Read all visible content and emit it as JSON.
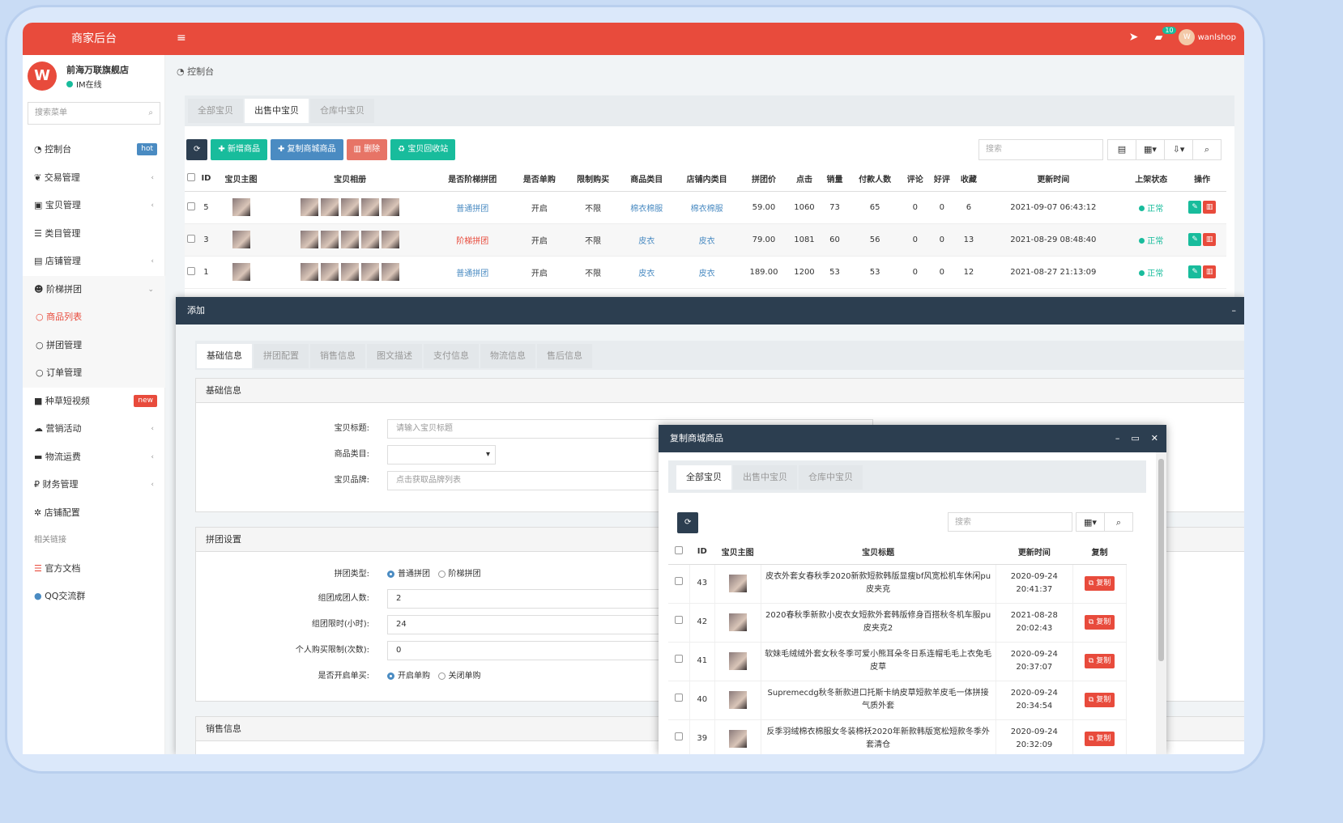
{
  "app": {
    "title": "商家后台",
    "menu_icon": "hamburger-icon",
    "notify_count": "10",
    "user": "wanlshop",
    "avatar_letter": "W"
  },
  "shop": {
    "name": "前海万联旗舰店",
    "status": "IM在线"
  },
  "sidebar": {
    "search_placeholder": "搜索菜单",
    "items": [
      {
        "label": "控制台",
        "tag": "hot",
        "icon": "dashboard-icon"
      },
      {
        "label": "交易管理",
        "icon": "leaf-icon"
      },
      {
        "label": "宝贝管理",
        "icon": "shop-icon"
      },
      {
        "label": "类目管理",
        "icon": "list-icon"
      },
      {
        "label": "店铺管理",
        "icon": "store-icon"
      },
      {
        "label": "阶梯拼团",
        "icon": "users-icon"
      },
      {
        "label": "商品列表"
      },
      {
        "label": "拼团管理"
      },
      {
        "label": "订单管理"
      },
      {
        "label": "种草短视频",
        "tag": "new",
        "icon": "video-icon"
      },
      {
        "label": "营销活动",
        "icon": "cloud-icon"
      },
      {
        "label": "物流运费",
        "icon": "truck-icon"
      },
      {
        "label": "财务管理",
        "icon": "ruble-icon"
      },
      {
        "label": "店铺配置",
        "icon": "gear-icon"
      },
      {
        "label": "相关链接"
      },
      {
        "label": "官方文档",
        "icon": "doc-icon"
      },
      {
        "label": "QQ交流群",
        "icon": "qq-icon"
      }
    ]
  },
  "breadcrumb": "控制台",
  "main_tabs": [
    "全部宝贝",
    "出售中宝贝",
    "仓库中宝贝"
  ],
  "toolbar": {
    "add": "新增商品",
    "copy": "复制商城商品",
    "delete": "删除",
    "recycle": "宝贝回收站",
    "search_placeholder": "搜索"
  },
  "table": {
    "headers": [
      "ID",
      "宝贝主图",
      "宝贝相册",
      "是否阶梯拼团",
      "是否单购",
      "限制购买",
      "商品类目",
      "店铺内类目",
      "拼团价",
      "点击",
      "销量",
      "付款人数",
      "评论",
      "好评",
      "收藏",
      "更新时间",
      "上架状态",
      "操作"
    ],
    "rows": [
      {
        "id": "5",
        "type": "普通拼团",
        "single": "开启",
        "limit": "不限",
        "cat": "棉衣棉服",
        "shopcat": "棉衣棉服",
        "price": "59.00",
        "clicks": "1060",
        "sales": "73",
        "payers": "65",
        "comments": "0",
        "good": "0",
        "fav": "6",
        "time": "2021-09-07 06:43:12",
        "status": "正常"
      },
      {
        "id": "3",
        "type": "阶梯拼团",
        "single": "开启",
        "limit": "不限",
        "cat": "皮衣",
        "shopcat": "皮衣",
        "price": "79.00",
        "clicks": "1081",
        "sales": "60",
        "payers": "56",
        "comments": "0",
        "good": "0",
        "fav": "13",
        "time": "2021-08-29 08:48:40",
        "status": "正常"
      },
      {
        "id": "1",
        "type": "普通拼团",
        "single": "开启",
        "limit": "不限",
        "cat": "皮衣",
        "shopcat": "皮衣",
        "price": "189.00",
        "clicks": "1200",
        "sales": "53",
        "payers": "53",
        "comments": "0",
        "good": "0",
        "fav": "12",
        "time": "2021-08-27 21:13:09",
        "status": "正常"
      }
    ]
  },
  "add_modal": {
    "title": "添加",
    "tabs": [
      "基础信息",
      "拼团配置",
      "销售信息",
      "图文描述",
      "支付信息",
      "物流信息",
      "售后信息"
    ],
    "basic": {
      "heading": "基础信息",
      "title_label": "宝贝标题:",
      "title_placeholder": "请输入宝贝标题",
      "cat_label": "商品类目:",
      "brand_label": "宝贝品牌:",
      "brand_placeholder": "点击获取品牌列表"
    },
    "group": {
      "heading": "拼团设置",
      "type_label": "拼团类型:",
      "type_opt1": "普通拼团",
      "type_opt2": "阶梯拼团",
      "num_label": "组团成团人数:",
      "num_value": "2",
      "limit_label": "组团限时(小时):",
      "limit_value": "24",
      "buy_label": "个人购买限制(次数):",
      "buy_value": "0",
      "single_label": "是否开启单买:",
      "single_opt1": "开启单购",
      "single_opt2": "关闭单购"
    },
    "sales": {
      "heading": "销售信息"
    }
  },
  "copy_modal": {
    "title": "复制商城商品",
    "tabs": [
      "全部宝贝",
      "出售中宝贝",
      "仓库中宝贝"
    ],
    "search_placeholder": "搜索",
    "headers": [
      "ID",
      "宝贝主图",
      "宝贝标题",
      "更新时间",
      "复制"
    ],
    "copy_label": "复制",
    "rows": [
      {
        "id": "43",
        "title": "皮衣外套女春秋季2020新款短款韩版显瘦bf风宽松机车休闲pu皮夹克",
        "date": "2020-09-24",
        "time": "20:41:37"
      },
      {
        "id": "42",
        "title": "2020春秋季新款小皮衣女短款外套韩版修身百搭秋冬机车服pu皮夹克2",
        "date": "2021-08-28",
        "time": "20:02:43"
      },
      {
        "id": "41",
        "title": "软妹毛绒绒外套女秋冬季可爱小熊耳朵冬日系连帽毛毛上衣兔毛皮草",
        "date": "2020-09-24",
        "time": "20:37:07"
      },
      {
        "id": "40",
        "title": "Supremecdg秋冬新款进口托斯卡纳皮草短款羊皮毛一体拼接气质外套",
        "date": "2020-09-24",
        "time": "20:34:54"
      },
      {
        "id": "39",
        "title": "反季羽绒棉衣棉服女冬装棉袄2020年新款韩版宽松短款冬季外套清仓",
        "date": "2020-09-24",
        "time": "20:32:09"
      }
    ]
  }
}
